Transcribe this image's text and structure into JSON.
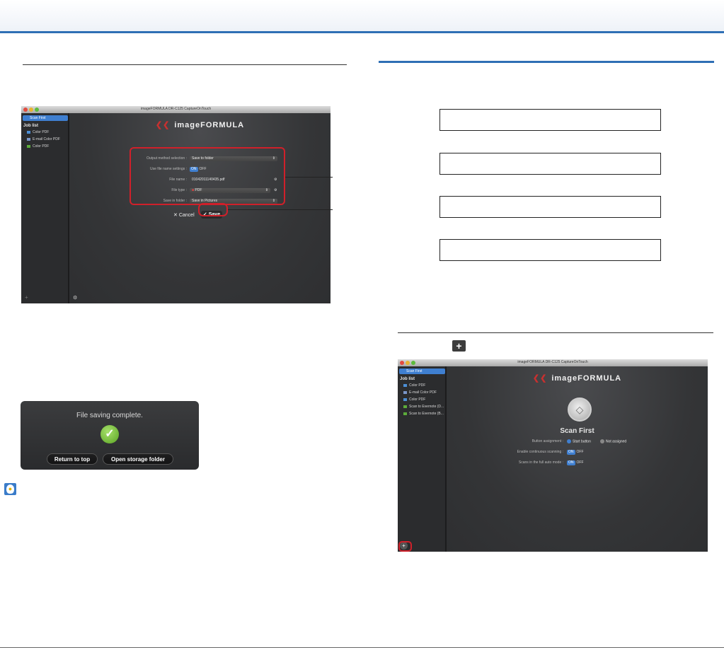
{
  "colors": {
    "accent_blue": "#2f6fb5",
    "highlight_red": "#d0202a",
    "app_dark": "#3a3b3d",
    "toggle_on": "#3f7fd0"
  },
  "window1": {
    "title": "imageFORMULA DR-C125 CaptureOnTouch",
    "sidebar": {
      "selected": "Scan First",
      "job_list_heading": "Job list",
      "items": [
        "Color PDF",
        "E-mail Color PDF",
        "Color PDF"
      ]
    },
    "brand": "imageFORMULA",
    "form": {
      "output_label": "Output method selection :",
      "output_value": "Save to folder",
      "use_file_name_label": "Use file name settings :",
      "toggle_on": "ON",
      "toggle_off": "OFF",
      "file_name_label": "File name :",
      "file_name_value": "01042011140435.pdf",
      "file_type_label": "File type :",
      "file_type_value": "PDF",
      "save_in_label": "Save in folder :",
      "save_in_value": "Save in Pictures"
    },
    "cancel_label": "Cancel",
    "save_label": "Save"
  },
  "dialog": {
    "message": "File saving complete.",
    "return_label": "Return to top",
    "open_label": "Open storage folder"
  },
  "window2": {
    "title": "imageFORMULA DR-C125 CaptureOnTouch",
    "sidebar": {
      "selected": "Scan First",
      "job_list_heading": "Job list",
      "items": [
        "Color PDF",
        "E-mail Color PDF",
        "Color PDF",
        "Scan to Evernote (D...",
        "Scan to Evernote (B..."
      ]
    },
    "brand": "imageFORMULA",
    "scan_title": "Scan First",
    "button_assignment_label": "Button assignment :",
    "start_button": "Start button",
    "not_assigned": "Not assigned",
    "continuous_label": "Enable continuous scanning :",
    "full_auto_label": "Scans in the full auto mode :",
    "toggle_on": "ON",
    "toggle_off": "OFF"
  }
}
